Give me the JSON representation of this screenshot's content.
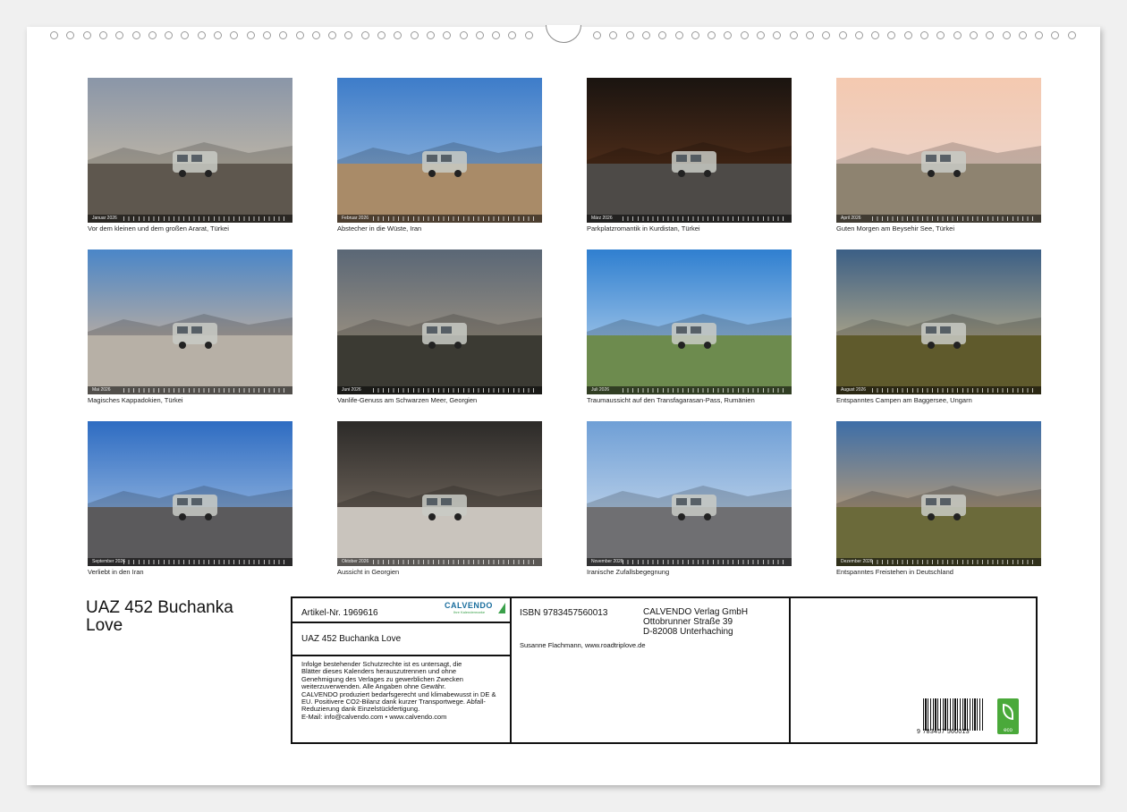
{
  "sheet": {
    "hole_count_left": 30,
    "hole_count_right": 30
  },
  "photos": [
    {
      "month": "Januar 2026",
      "caption": "Vor dem kleinen und dem großen Ararat, Türkei",
      "sky_top": "#8a96a8",
      "sky_bottom": "#d9c6a6",
      "ground": "#5e574e"
    },
    {
      "month": "Februar 2026",
      "caption": "Abstecher in die Wüste, Iran",
      "sky_top": "#3d7cc9",
      "sky_bottom": "#a9c6e3",
      "ground": "#a98b68"
    },
    {
      "month": "März 2026",
      "caption": "Parkplatzromantik in Kurdistan, Türkei",
      "sky_top": "#1a1410",
      "sky_bottom": "#6b3a1e",
      "ground": "#4d4a47"
    },
    {
      "month": "April 2026",
      "caption": "Guten Morgen am Beysehir See, Türkei",
      "sky_top": "#f4c9b0",
      "sky_bottom": "#e8d8d4",
      "ground": "#8e8370"
    },
    {
      "month": "Mai 2026",
      "caption": "Magisches Kappadokien, Türkei",
      "sky_top": "#4a86c8",
      "sky_bottom": "#f2c08e",
      "ground": "#b7b0a6"
    },
    {
      "month": "Juni 2026",
      "caption": "Vanlife-Genuss am Schwarzen Meer, Georgien",
      "sky_top": "#5a6776",
      "sky_bottom": "#b9a486",
      "ground": "#3b3a33"
    },
    {
      "month": "Juli 2026",
      "caption": "Traumaussicht auf den Transfagarasan-Pass, Rumänien",
      "sky_top": "#2f7fd0",
      "sky_bottom": "#cfe2f2",
      "ground": "#6d8b4e"
    },
    {
      "month": "August 2026",
      "caption": "Entspanntes Campen am Baggersee, Ungarn",
      "sky_top": "#3b5f86",
      "sky_bottom": "#e8c98a",
      "ground": "#5f5a2c"
    },
    {
      "month": "September 2026",
      "caption": "Verliebt in den Iran",
      "sky_top": "#2e6cc2",
      "sky_bottom": "#b8d0ea",
      "ground": "#5b5a5c"
    },
    {
      "month": "Oktober 2026",
      "caption": "Aussicht in Georgien",
      "sky_top": "#2c2a28",
      "sky_bottom": "#8a7d70",
      "ground": "#c9c4bd"
    },
    {
      "month": "November 2026",
      "caption": "Iranische Zufallsbegegnung",
      "sky_top": "#6f9fd6",
      "sky_bottom": "#dbe6f1",
      "ground": "#6f6f72"
    },
    {
      "month": "Dezember 2026",
      "caption": "Entspanntes Freistehen in Deutschland",
      "sky_top": "#3d6ea8",
      "sky_bottom": "#f0b060",
      "ground": "#6b6a3a"
    }
  ],
  "title": "UAZ 452 Buchanka Love",
  "info": {
    "article": "Artikel-Nr. 1969616",
    "logo_text": "CALVENDO",
    "logo_sub": "Ihre Kalendermarke",
    "product_title": "UAZ 452 Buchanka Love",
    "legal": "Infolge bestehender Schutzrechte ist es untersagt, die\nBlätter dieses Kalenders herauszutrennen und ohne\nGenehmigung des Verlages zu gewerblichen Zwecken\nweiterzuverwenden. Alle Angaben ohne Gewähr.\nCALVENDO produziert bedarfsgerecht und klimabewusst in DE &\nEU. Positivere CO2-Bilanz dank kurzer Transportwege. Abfall-\nReduzierung dank Einzelstückfertigung.\nE-Mail: info@calvendo.com • www.calvendo.com",
    "isbn": "ISBN 9783457560013",
    "publisher_name": "CALVENDO Verlag GmbH",
    "publisher_street": "Ottobrunner Straße 39",
    "publisher_city": "D-82008 Unterhaching",
    "author": "Susanne Flachmann, www.roadtriplove.de",
    "barcode_number": "9 783457 560013",
    "eco_label": "eco"
  }
}
